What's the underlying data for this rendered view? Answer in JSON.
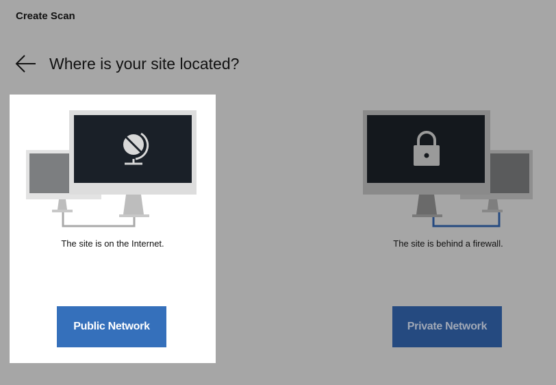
{
  "header": {
    "title": "Create Scan"
  },
  "page": {
    "title": "Where is your site located?"
  },
  "icons": {
    "back": "arrow-left-icon",
    "public": "globe-icon",
    "private": "lock-icon"
  },
  "options": {
    "public": {
      "caption": "The site is on the Internet.",
      "button_label": "Public Network",
      "selected": true
    },
    "private": {
      "caption": "The site is behind a firewall.",
      "button_label": "Private Network",
      "selected": false
    }
  },
  "colors": {
    "background": "#a6a6a6",
    "selected_card": "#ffffff",
    "public_button": "#3570bb",
    "private_button": "#254a80"
  }
}
